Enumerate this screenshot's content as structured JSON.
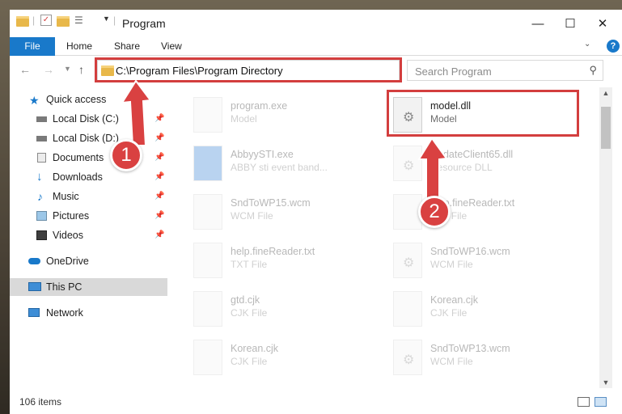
{
  "window": {
    "title": "Program",
    "controls": {
      "minimize": "—",
      "maximize": "☐",
      "close": "✕"
    }
  },
  "ribbon": {
    "tabs": [
      "File",
      "Home",
      "Share",
      "View"
    ],
    "help": "?"
  },
  "address_bar": {
    "path": "C:\\Program Files\\Program Directory",
    "search_placeholder": "Search Program"
  },
  "sidebar": {
    "items": [
      {
        "label": "Quick access",
        "icon": "star-icon",
        "pinned": false
      },
      {
        "label": "Local Disk (C:)",
        "icon": "drive-icon",
        "pinned": true
      },
      {
        "label": "Local Disk (D:)",
        "icon": "drive-icon",
        "pinned": true
      },
      {
        "label": "Documents",
        "icon": "documents-icon",
        "pinned": true
      },
      {
        "label": "Downloads",
        "icon": "download-icon",
        "pinned": true
      },
      {
        "label": "Music",
        "icon": "music-icon",
        "pinned": true
      },
      {
        "label": "Pictures",
        "icon": "pictures-icon",
        "pinned": true
      },
      {
        "label": "Videos",
        "icon": "videos-icon",
        "pinned": true
      },
      {
        "label": "OneDrive",
        "icon": "cloud-icon",
        "pinned": false
      },
      {
        "label": "This PC",
        "icon": "computer-icon",
        "pinned": false,
        "selected": true
      },
      {
        "label": "Network",
        "icon": "network-icon",
        "pinned": false
      }
    ]
  },
  "files": [
    {
      "name": "program.exe",
      "type": "Model",
      "faded": true
    },
    {
      "name": "model.dll",
      "type": "Model",
      "faded": false,
      "highlighted": true
    },
    {
      "name": "AbbyySTI.exe",
      "type": "ABBY sti event band...",
      "faded": true
    },
    {
      "name": "UpdateClient65.dll",
      "type": "Resource DLL",
      "faded": true
    },
    {
      "name": "SndToWP15.wcm",
      "type": "WCM File",
      "faded": true
    },
    {
      "name": "help.fineReader.txt",
      "type": "TXT File",
      "faded": true
    },
    {
      "name": "help.fineReader.txt",
      "type": "TXT File",
      "faded": true
    },
    {
      "name": "SndToWP16.wcm",
      "type": "WCM File",
      "faded": true
    },
    {
      "name": "gtd.cjk",
      "type": "CJK File",
      "faded": true
    },
    {
      "name": "Korean.cjk",
      "type": "CJK File",
      "faded": true
    },
    {
      "name": "Korean.cjk",
      "type": "CJK File",
      "faded": true
    },
    {
      "name": "SndToWP13.wcm",
      "type": "WCM File",
      "faded": true
    }
  ],
  "status": {
    "item_count": "106 items"
  },
  "annotations": [
    "1",
    "2"
  ],
  "colors": {
    "accent": "#1979ca",
    "highlight": "#d33e3e",
    "badge": "#d94141"
  }
}
